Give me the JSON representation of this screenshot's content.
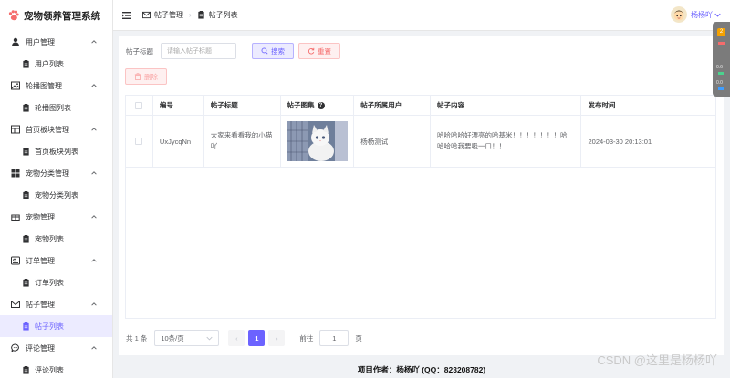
{
  "app": {
    "title": "宠物领养管理系统"
  },
  "sidebar": {
    "groups": [
      {
        "label": "用户管理",
        "icon": "user-icon",
        "item": "用户列表"
      },
      {
        "label": "轮播图管理",
        "icon": "image-icon",
        "item": "轮播图列表"
      },
      {
        "label": "首页板块管理",
        "icon": "blocks-icon",
        "item": "首页板块列表"
      },
      {
        "label": "宠物分类管理",
        "icon": "grid-icon",
        "item": "宠物分类列表"
      },
      {
        "label": "宠物管理",
        "icon": "gift-box-icon",
        "item": "宠物列表"
      },
      {
        "label": "订单管理",
        "icon": "order-icon",
        "item": "订单列表"
      },
      {
        "label": "帖子管理",
        "icon": "mail-icon",
        "item": "帖子列表"
      },
      {
        "label": "评论管理",
        "icon": "comment-icon",
        "item": "评论列表"
      }
    ],
    "active_item": "帖子列表"
  },
  "header": {
    "breadcrumb": [
      "帖子管理",
      "帖子列表"
    ],
    "user_name": "杨杨吖"
  },
  "search": {
    "label": "帖子标题",
    "placeholder": "请输入帖子标题",
    "search_button": "搜索",
    "reset_button": "重置",
    "delete_button": "删除"
  },
  "table": {
    "columns": [
      "编号",
      "帖子标题",
      "帖子图集",
      "帖子所属用户",
      "帖子内容",
      "发布时间"
    ],
    "rows": [
      {
        "id": "UxJycqNn",
        "title": "大家来看看我的小猫吖",
        "image": "white-cat-photo",
        "user": "杨杨测试",
        "content": "哈哈哈哈好漂亮的哈基米！！！！！！！哈哈哈哈我要吸一口！！",
        "time": "2024-03-30 20:13:01"
      }
    ]
  },
  "pagination": {
    "total": "共 1 条",
    "page_size": "10条/页",
    "current_page": "1",
    "goto_label": "前往",
    "goto_value": "1",
    "goto_suffix": "页"
  },
  "footer": {
    "text": "项目作者：杨杨吖 (QQ：823208782)"
  },
  "watermark": "CSDN @这里是杨杨吖",
  "float_bar": {
    "badge": "2",
    "stat1": "0.6",
    "stat2": "0.0"
  },
  "colors": {
    "accent": "#6c63ff",
    "danger": "#f56c6c",
    "active_bg": "#ecebff"
  }
}
